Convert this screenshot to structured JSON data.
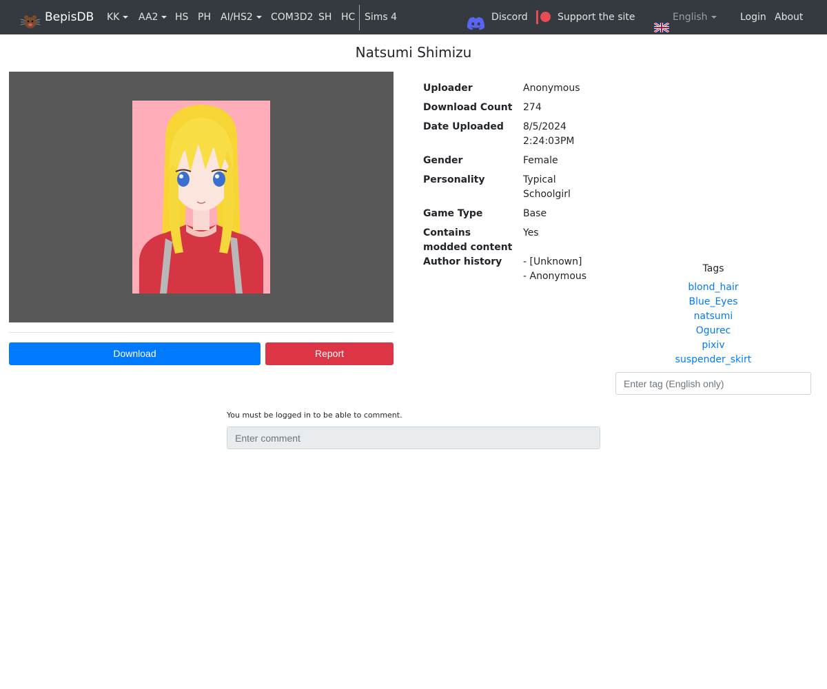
{
  "nav": {
    "brand": "BepisDB",
    "items": [
      {
        "label": "KK",
        "dropdown": true
      },
      {
        "label": "AA2",
        "dropdown": true
      },
      {
        "label": "HS",
        "dropdown": false
      },
      {
        "label": "PH",
        "dropdown": false
      },
      {
        "label": "AI/HS2",
        "dropdown": true
      },
      {
        "label": "COM3D2",
        "dropdown": false
      },
      {
        "label": "SH",
        "dropdown": false
      },
      {
        "label": "HC",
        "dropdown": false
      },
      {
        "label": "Sims 4",
        "dropdown": false
      }
    ],
    "discord": "Discord",
    "support": "Support the site",
    "language": "English",
    "login": "Login",
    "about": "About"
  },
  "card": {
    "title": "Natsumi Shimizu",
    "download_label": "Download",
    "report_label": "Report"
  },
  "info": [
    {
      "key": "Uploader",
      "value": "Anonymous"
    },
    {
      "key": "Download Count",
      "value": "274"
    },
    {
      "key": "Date Uploaded",
      "value": "8/5/2024\n2:24:03PM"
    },
    {
      "key": "Gender",
      "value": "Female"
    },
    {
      "key": "Personality",
      "value": "Typical\nSchoolgirl"
    },
    {
      "key": "Game Type",
      "value": "Base"
    },
    {
      "key": "Contains\nmodded content",
      "value": "Yes"
    },
    {
      "key": "Author history",
      "value": "- [Unknown]\n- Anonymous"
    }
  ],
  "tags": {
    "heading": "Tags",
    "items": [
      "blond_hair",
      "Blue_Eyes",
      "natsumi",
      "Ogurec",
      "pixiv",
      "suspender_skirt"
    ],
    "input_placeholder": "Enter tag (English only)"
  },
  "comments": {
    "note": "You must be logged in to be able to comment.",
    "input_placeholder": "Enter comment"
  },
  "colors": {
    "navbar": "#343a40",
    "primary": "#007bff",
    "danger": "#dc3545",
    "link": "#007bff",
    "preview_bg": "#585858",
    "card_bg": "#ffaeb9"
  },
  "icons": {
    "brand": "bepis-logo-icon",
    "discord": "discord-icon",
    "support": "patreon-icon",
    "language": "uk-flag-icon"
  }
}
